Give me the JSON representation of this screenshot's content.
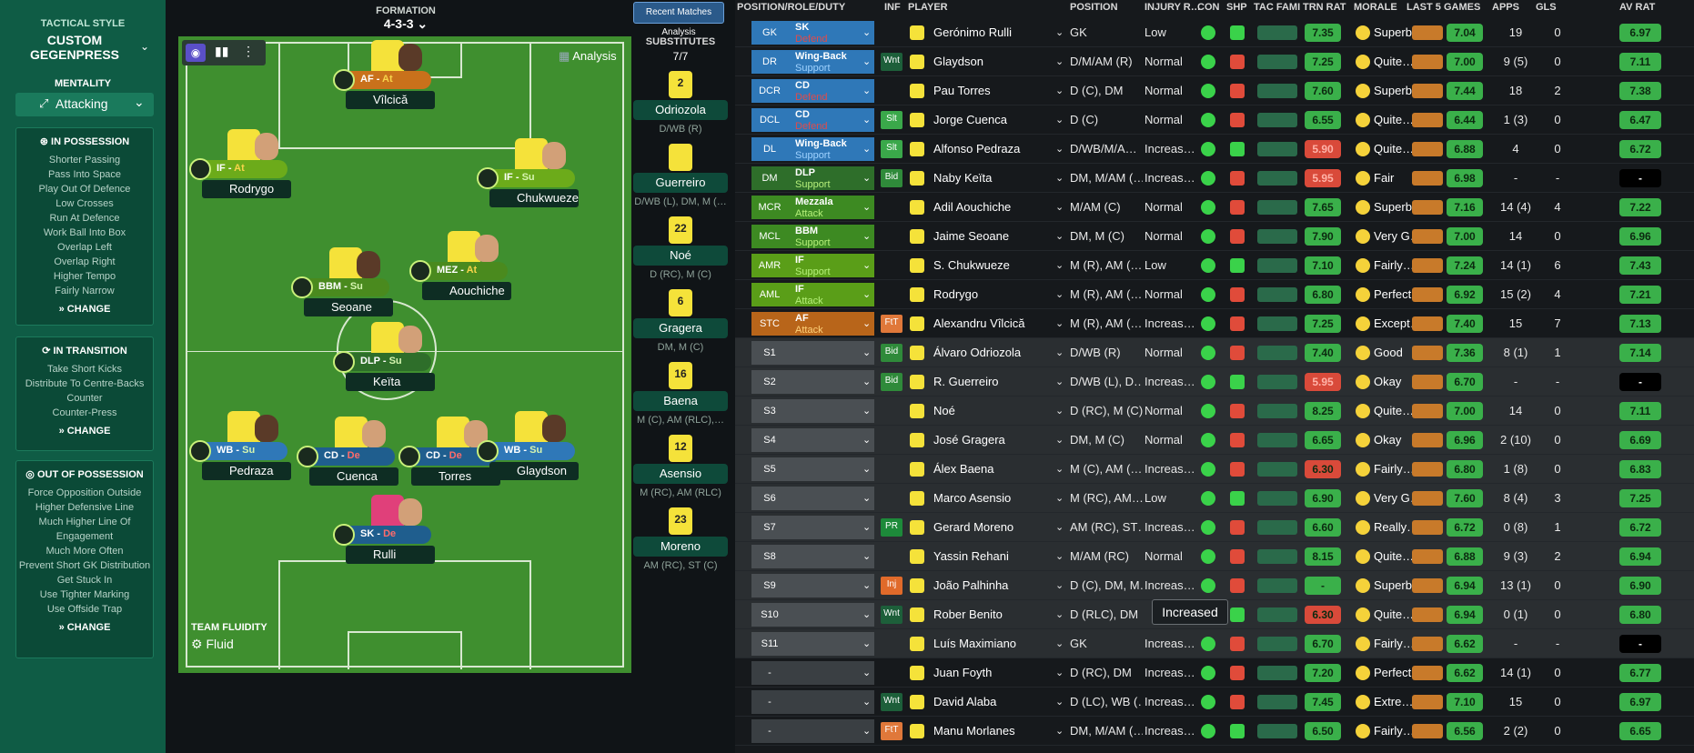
{
  "tactic": {
    "style_label": "TACTICAL STYLE",
    "style_name": "CUSTOM GEGENPRESS",
    "mentality_label": "MENTALITY",
    "mentality": "Attacking",
    "fluidity_label": "TEAM FLUIDITY",
    "fluidity": "Fluid",
    "in_possession": {
      "title": "IN POSSESSION",
      "items": [
        "Shorter Passing",
        "Pass Into Space",
        "Play Out Of Defence",
        "Low Crosses",
        "Run At Defence",
        "Work Ball Into Box",
        "Overlap Left",
        "Overlap Right",
        "Higher Tempo",
        "Fairly Narrow"
      ]
    },
    "in_transition": {
      "title": "IN TRANSITION",
      "items": [
        "Take Short Kicks",
        "Distribute To Centre-Backs",
        "Counter",
        "Counter-Press"
      ]
    },
    "out_of_possession": {
      "title": "OUT OF POSSESSION",
      "items": [
        "Force Opposition Outside",
        "Higher Defensive Line",
        "Much Higher Line Of Engagement",
        "Much More Often",
        "Prevent Short GK Distribution",
        "Get Stuck In",
        "Use Tighter Marking",
        "Use Offside Trap"
      ]
    },
    "change_label": "CHANGE"
  },
  "formation": {
    "label": "FORMATION",
    "value": "4-3-3"
  },
  "analysis_label": "Analysis",
  "recent_button": "Recent Matches Analysis",
  "pitch_players": [
    {
      "role": "AF",
      "duty": "At",
      "name": "Vîlcică",
      "color": "#c9711b"
    },
    {
      "role": "IF",
      "duty": "At",
      "name": "Rodrygo",
      "color": "#6cab1a"
    },
    {
      "role": "IF",
      "duty": "Su",
      "name": "Chukwueze",
      "color": "#6cab1a"
    },
    {
      "role": "BBM",
      "duty": "Su",
      "name": "Seoane",
      "color": "#4a8a1e"
    },
    {
      "role": "MEZ",
      "duty": "At",
      "name": "Aouchiche",
      "color": "#4a8a1e"
    },
    {
      "role": "DLP",
      "duty": "Su",
      "name": "Keïta",
      "color": "#2e6e2a"
    },
    {
      "role": "WB",
      "duty": "Su",
      "name": "Pedraza",
      "color": "#2f78b8"
    },
    {
      "role": "CD",
      "duty": "De",
      "name": "Cuenca",
      "color": "#1f5e8e"
    },
    {
      "role": "CD",
      "duty": "De",
      "name": "Torres",
      "color": "#1f5e8e"
    },
    {
      "role": "WB",
      "duty": "Su",
      "name": "Glaydson",
      "color": "#2f78b8"
    },
    {
      "role": "SK",
      "duty": "De",
      "name": "Rulli",
      "color": "#1f5e8e"
    }
  ],
  "subs": {
    "label": "SUBSTITUTES",
    "count": "7/7",
    "players": [
      {
        "num": "2",
        "name": "Odriozola",
        "pos": "D/WB (R)"
      },
      {
        "num": "",
        "name": "Guerreiro",
        "pos": "D/WB (L), DM, M (…"
      },
      {
        "num": "22",
        "name": "Noé",
        "pos": "D (RC), M (C)"
      },
      {
        "num": "6",
        "name": "Gragera",
        "pos": "DM, M (C)"
      },
      {
        "num": "16",
        "name": "Baena",
        "pos": "M (C), AM (RLC),…"
      },
      {
        "num": "12",
        "name": "Asensio",
        "pos": "M (RC), AM (RLC)"
      },
      {
        "num": "23",
        "name": "Moreno",
        "pos": "AM (RC), ST (C)"
      }
    ]
  },
  "headers": [
    "POSITION/ROLE/DUTY",
    "INF",
    "PLAYER",
    "POSITION",
    "INJURY R…",
    "CON",
    "SHP",
    "TAC FAMI",
    "TRN RAT",
    "MORALE",
    "LAST 5 GAMES",
    "APPS",
    "GLS",
    "AV RAT"
  ],
  "tooltip": "Increased",
  "rows": [
    {
      "key": "GK",
      "role": "SK",
      "duty": "Defend",
      "dcol": "#e04b4b",
      "bg": "#2f78b8",
      "inf": "",
      "name": "Gerónimo Rulli",
      "pos": "GK",
      "inj": "Low",
      "trn": "7.35",
      "mor": "Superb",
      "l5": "7.04",
      "apps": "19",
      "gls": "0",
      "av": "6.97"
    },
    {
      "key": "DR",
      "role": "Wing-Back",
      "duty": "Support",
      "dcol": "#9fd2ff",
      "bg": "#2f78b8",
      "inf": "Wnt",
      "name": "Glaydson",
      "pos": "D/M/AM (R)",
      "inj": "Normal",
      "trn": "7.25",
      "mor": "Quite…",
      "l5": "7.00",
      "apps": "9 (5)",
      "gls": "0",
      "av": "7.11"
    },
    {
      "key": "DCR",
      "role": "CD",
      "duty": "Defend",
      "dcol": "#e04b4b",
      "bg": "#2f78b8",
      "inf": "",
      "name": "Pau Torres",
      "pos": "D (C), DM",
      "inj": "Normal",
      "trn": "7.60",
      "mor": "Superb",
      "l5": "7.44",
      "apps": "18",
      "gls": "2",
      "av": "7.38"
    },
    {
      "key": "DCL",
      "role": "CD",
      "duty": "Defend",
      "dcol": "#e04b4b",
      "bg": "#2f78b8",
      "inf": "Slt",
      "name": "Jorge Cuenca",
      "pos": "D (C)",
      "inj": "Normal",
      "trn": "6.55",
      "mor": "Quite…",
      "l5": "6.44",
      "apps": "1 (3)",
      "gls": "0",
      "av": "6.47"
    },
    {
      "key": "DL",
      "role": "Wing-Back",
      "duty": "Support",
      "dcol": "#9fd2ff",
      "bg": "#2f78b8",
      "inf": "Slt",
      "name": "Alfonso Pedraza",
      "pos": "D/WB/M/A…",
      "inj": "Increas…",
      "trn": "5.90",
      "mor": "Quite…",
      "l5": "6.88",
      "apps": "4",
      "gls": "0",
      "av": "6.72"
    },
    {
      "key": "DM",
      "role": "DLP",
      "duty": "Support",
      "dcol": "#b6f07a",
      "bg": "#2e6e2a",
      "inf": "Bid",
      "name": "Naby Keïta",
      "pos": "DM, M/AM (…",
      "inj": "Increas…",
      "trn": "5.95",
      "mor": "Fair",
      "l5": "6.98",
      "apps": "-",
      "gls": "-",
      "av": "-"
    },
    {
      "key": "MCR",
      "role": "Mezzala",
      "duty": "Attack",
      "dcol": "#b6f07a",
      "bg": "#3d8a22",
      "inf": "",
      "name": "Adil Aouchiche",
      "pos": "M/AM (C)",
      "inj": "Normal",
      "trn": "7.65",
      "mor": "Superb",
      "l5": "7.16",
      "apps": "14 (4)",
      "gls": "4",
      "av": "7.22"
    },
    {
      "key": "MCL",
      "role": "BBM",
      "duty": "Support",
      "dcol": "#b6f07a",
      "bg": "#3d8a22",
      "inf": "",
      "name": "Jaime Seoane",
      "pos": "DM, M (C)",
      "inj": "Normal",
      "trn": "7.90",
      "mor": "Very G…",
      "l5": "7.00",
      "apps": "14",
      "gls": "0",
      "av": "6.96"
    },
    {
      "key": "AMR",
      "role": "IF",
      "duty": "Support",
      "dcol": "#b6f07a",
      "bg": "#5a9e18",
      "inf": "",
      "name": "S. Chukwueze",
      "pos": "M (R), AM (…",
      "inj": "Low",
      "trn": "7.10",
      "mor": "Fairly…",
      "l5": "7.24",
      "apps": "14 (1)",
      "gls": "6",
      "av": "7.43"
    },
    {
      "key": "AML",
      "role": "IF",
      "duty": "Attack",
      "dcol": "#b6f07a",
      "bg": "#5a9e18",
      "inf": "",
      "name": "Rodrygo",
      "pos": "M (R), AM (…",
      "inj": "Normal",
      "trn": "6.80",
      "mor": "Perfect",
      "l5": "6.92",
      "apps": "15 (2)",
      "gls": "4",
      "av": "7.21"
    },
    {
      "key": "STC",
      "role": "AF",
      "duty": "Attack",
      "dcol": "#ffd27a",
      "bg": "#b8651a",
      "inf": "FtT",
      "name": "Alexandru Vîlcică",
      "pos": "M (R), AM (…",
      "inj": "Increas…",
      "trn": "7.25",
      "mor": "Except…",
      "l5": "7.40",
      "apps": "15",
      "gls": "7",
      "av": "7.13"
    },
    {
      "key": "S1",
      "role": "",
      "duty": "",
      "dcol": "",
      "bg": "#4a4f53",
      "inf": "Bid",
      "name": "Álvaro Odriozola",
      "pos": "D/WB (R)",
      "inj": "Normal",
      "trn": "7.40",
      "mor": "Good",
      "l5": "7.36",
      "apps": "8 (1)",
      "gls": "1",
      "av": "7.14"
    },
    {
      "key": "S2",
      "role": "",
      "duty": "",
      "dcol": "",
      "bg": "#4a4f53",
      "inf": "Bid",
      "name": "R. Guerreiro",
      "pos": "D/WB (L), D…",
      "inj": "Increas…",
      "trn": "5.95",
      "mor": "Okay",
      "l5": "6.70",
      "apps": "-",
      "gls": "-",
      "av": "-"
    },
    {
      "key": "S3",
      "role": "",
      "duty": "",
      "dcol": "",
      "bg": "#4a4f53",
      "inf": "",
      "name": "Noé",
      "pos": "D (RC), M (C)",
      "inj": "Normal",
      "trn": "8.25",
      "mor": "Quite…",
      "l5": "7.00",
      "apps": "14",
      "gls": "0",
      "av": "7.11"
    },
    {
      "key": "S4",
      "role": "",
      "duty": "",
      "dcol": "",
      "bg": "#4a4f53",
      "inf": "",
      "name": "José Gragera",
      "pos": "DM, M (C)",
      "inj": "Normal",
      "trn": "6.65",
      "mor": "Okay",
      "l5": "6.96",
      "apps": "2 (10)",
      "gls": "0",
      "av": "6.69"
    },
    {
      "key": "S5",
      "role": "",
      "duty": "",
      "dcol": "",
      "bg": "#4a4f53",
      "inf": "",
      "name": "Álex Baena",
      "pos": "M (C), AM (…",
      "inj": "Increas…",
      "trn": "6.30",
      "mor": "Fairly…",
      "l5": "6.80",
      "apps": "1 (8)",
      "gls": "0",
      "av": "6.83"
    },
    {
      "key": "S6",
      "role": "",
      "duty": "",
      "dcol": "",
      "bg": "#4a4f53",
      "inf": "",
      "name": "Marco Asensio",
      "pos": "M (RC), AM…",
      "inj": "Low",
      "trn": "6.90",
      "mor": "Very G…",
      "l5": "7.60",
      "apps": "8 (4)",
      "gls": "3",
      "av": "7.25"
    },
    {
      "key": "S7",
      "role": "",
      "duty": "",
      "dcol": "",
      "bg": "#4a4f53",
      "inf": "PR",
      "name": "Gerard Moreno",
      "pos": "AM (RC), ST…",
      "inj": "Increas…",
      "trn": "6.60",
      "mor": "Really…",
      "l5": "6.72",
      "apps": "0 (8)",
      "gls": "1",
      "av": "6.72"
    },
    {
      "key": "S8",
      "role": "",
      "duty": "",
      "dcol": "",
      "bg": "#4a4f53",
      "inf": "",
      "name": "Yassin Rehani",
      "pos": "M/AM (RC)",
      "inj": "Normal",
      "trn": "8.15",
      "mor": "Quite…",
      "l5": "6.88",
      "apps": "9 (3)",
      "gls": "2",
      "av": "6.94"
    },
    {
      "key": "S9",
      "role": "",
      "duty": "",
      "dcol": "",
      "bg": "#4a4f53",
      "inf": "Inj",
      "name": "João Palhinha",
      "pos": "D (C), DM, M…",
      "inj": "Increas…",
      "trn": "-",
      "mor": "Superb",
      "l5": "6.94",
      "apps": "13 (1)",
      "gls": "0",
      "av": "6.90"
    },
    {
      "key": "S10",
      "role": "",
      "duty": "",
      "dcol": "",
      "bg": "#4a4f53",
      "inf": "Wnt",
      "name": "Rober Benito",
      "pos": "D (RLC), DM",
      "inj": "",
      "trn": "6.30",
      "mor": "Quite…",
      "l5": "6.94",
      "apps": "0 (1)",
      "gls": "0",
      "av": "6.80"
    },
    {
      "key": "S11",
      "role": "",
      "duty": "",
      "dcol": "",
      "bg": "#4a4f53",
      "inf": "",
      "name": "Luís Maximiano",
      "pos": "GK",
      "inj": "Increas…",
      "trn": "6.70",
      "mor": "Fairly…",
      "l5": "6.62",
      "apps": "-",
      "gls": "-",
      "av": "-"
    },
    {
      "key": "-",
      "role": "",
      "duty": "",
      "dcol": "",
      "bg": "#3a3f43",
      "inf": "",
      "name": "Juan Foyth",
      "pos": "D (RC), DM",
      "inj": "Increas…",
      "trn": "7.20",
      "mor": "Perfect",
      "l5": "6.62",
      "apps": "14 (1)",
      "gls": "0",
      "av": "6.77"
    },
    {
      "key": "-",
      "role": "",
      "duty": "",
      "dcol": "",
      "bg": "#3a3f43",
      "inf": "Wnt",
      "name": "David Alaba",
      "pos": "D (LC), WB (…",
      "inj": "Increas…",
      "trn": "7.45",
      "mor": "Extre…",
      "l5": "7.10",
      "apps": "15",
      "gls": "0",
      "av": "6.97"
    },
    {
      "key": "-",
      "role": "",
      "duty": "",
      "dcol": "",
      "bg": "#3a3f43",
      "inf": "FtT",
      "name": "Manu Morlanes",
      "pos": "DM, M/AM (…",
      "inj": "Increas…",
      "trn": "6.50",
      "mor": "Fairly…",
      "l5": "6.56",
      "apps": "2 (2)",
      "gls": "0",
      "av": "6.65"
    }
  ]
}
